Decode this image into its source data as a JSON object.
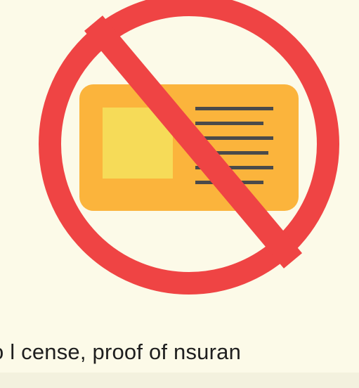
{
  "caption": {
    "text": "o l cense, proof of  nsuran"
  },
  "illustration": {
    "symbol_icon": "no-entry-icon",
    "card_icon": "id-card-icon",
    "colors": {
      "background": "#fcfae8",
      "prohibition_red": "#ef4444",
      "card_orange": "#fbb43c",
      "photo_yellow": "#f6db58",
      "text_lines": "#4a4a4a"
    }
  }
}
